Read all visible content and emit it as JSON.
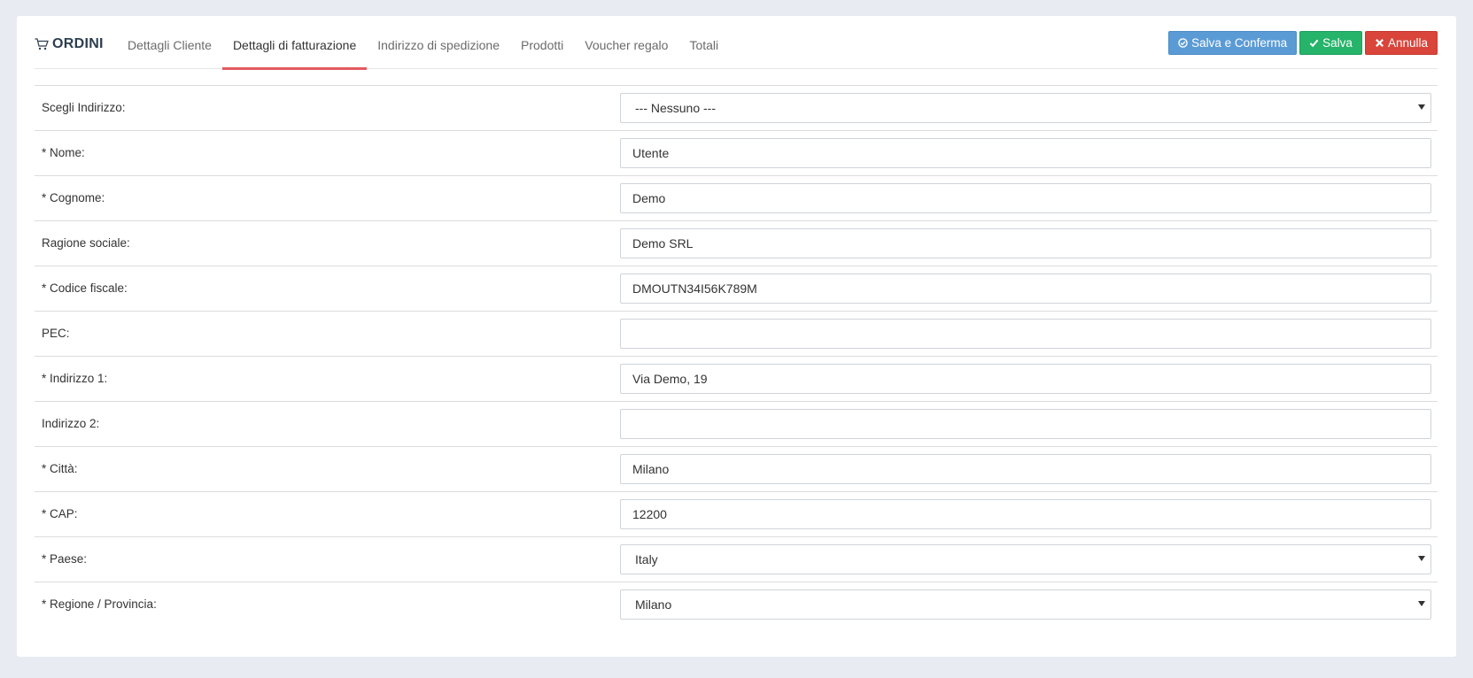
{
  "header": {
    "brand": "ORDINI",
    "tabs": [
      {
        "label": "Dettagli Cliente"
      },
      {
        "label": "Dettagli di fatturazione"
      },
      {
        "label": "Indirizzo di spedizione"
      },
      {
        "label": "Prodotti"
      },
      {
        "label": "Voucher regalo"
      },
      {
        "label": "Totali"
      }
    ],
    "active_tab": "Dettagli di fatturazione",
    "actions": {
      "confirm_label": "Salva e Conferma",
      "save_label": "Salva",
      "cancel_label": "Annulla"
    }
  },
  "form": {
    "choose_address": {
      "label": "Scegli Indirizzo:",
      "value": "--- Nessuno ---"
    },
    "first_name": {
      "label": "* Nome:",
      "value": "Utente"
    },
    "last_name": {
      "label": "* Cognome:",
      "value": "Demo"
    },
    "company": {
      "label": "Ragione sociale:",
      "value": "Demo SRL"
    },
    "tax_code": {
      "label": "* Codice fiscale:",
      "value": "DMOUTN34I56K789M"
    },
    "pec": {
      "label": "PEC:",
      "value": ""
    },
    "address1": {
      "label": "* Indirizzo 1:",
      "value": "Via Demo, 19"
    },
    "address2": {
      "label": "Indirizzo 2:",
      "value": ""
    },
    "city": {
      "label": "* Città:",
      "value": "Milano"
    },
    "postcode": {
      "label": "* CAP:",
      "value": "12200"
    },
    "country": {
      "label": "* Paese:",
      "value": "Italy"
    },
    "region": {
      "label": "* Regione / Provincia:",
      "value": "Milano"
    }
  },
  "colors": {
    "accent_tab": "#e25a5f",
    "confirm": "#5b9bd5",
    "save": "#26b36a",
    "cancel": "#d9453b",
    "background": "#e9ebf2"
  },
  "icons": {
    "brand": "shopping-cart-icon",
    "confirm": "check-circle-icon",
    "save": "check-icon",
    "cancel": "close-icon"
  }
}
